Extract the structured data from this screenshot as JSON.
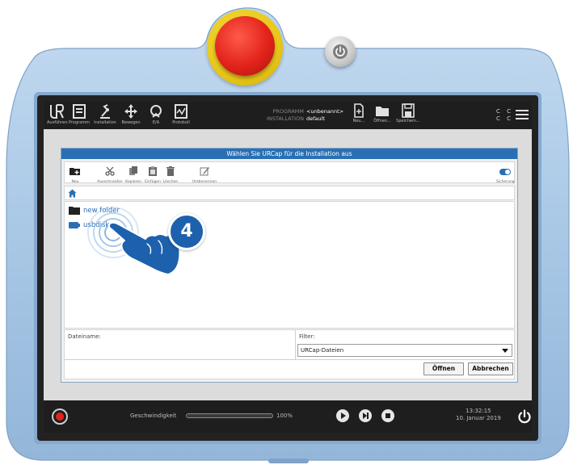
{
  "topbar": {
    "nav": [
      {
        "label": "Ausführen",
        "icon": "ur-logo-icon"
      },
      {
        "label": "Programm",
        "icon": "program-icon"
      },
      {
        "label": "Installation",
        "icon": "installation-icon"
      },
      {
        "label": "Bewegen",
        "icon": "move-icon"
      },
      {
        "label": "E/A",
        "icon": "io-icon"
      },
      {
        "label": "Protokoll",
        "icon": "log-icon"
      }
    ],
    "program_key": "PROGRAMM",
    "program_value": "<unbenannt>",
    "installation_key": "INSTALLATION",
    "installation_value": "default",
    "file_buttons": [
      {
        "label": "Neu...",
        "icon": "new-file-icon"
      },
      {
        "label": "Öffnen...",
        "icon": "open-folder-icon"
      },
      {
        "label": "Speichern...",
        "icon": "save-icon"
      }
    ],
    "cc_text": "C C",
    "cc_text2": "C C"
  },
  "dialog": {
    "title": "Wählen Sie URCap für die Installation aus",
    "toolbar": [
      {
        "label": "Neu",
        "icon": "new-folder-icon"
      },
      {
        "label": "Ausschneiden",
        "icon": "cut-icon"
      },
      {
        "label": "Kopieren",
        "icon": "copy-icon"
      },
      {
        "label": "Einfügen",
        "icon": "paste-icon"
      },
      {
        "label": "Löschen",
        "icon": "delete-icon"
      },
      {
        "label": "Umbenennen",
        "icon": "rename-icon"
      }
    ],
    "backup_label": "Sicherung",
    "files": [
      {
        "name": "new folder",
        "icon": "folder-icon"
      },
      {
        "name": "usbdisk",
        "icon": "usb-drive-icon"
      }
    ],
    "filename_label": "Dateiname:",
    "filter_label": "Filter:",
    "filter_value": "URCap-Dateien",
    "open_button": "Öffnen",
    "cancel_button": "Abbrechen"
  },
  "bottombar": {
    "speed_label": "Geschwindigkeit",
    "speed_value": "100%",
    "speed_fraction": 1.0,
    "time": "13:32:15",
    "date": "10. Januar 2019"
  },
  "overlay": {
    "step_number": "4"
  },
  "colors": {
    "housing": "#a9c8e6",
    "accent": "#2a6fb4",
    "estop": "#e2231a",
    "estop_ring": "#e9c81a"
  }
}
